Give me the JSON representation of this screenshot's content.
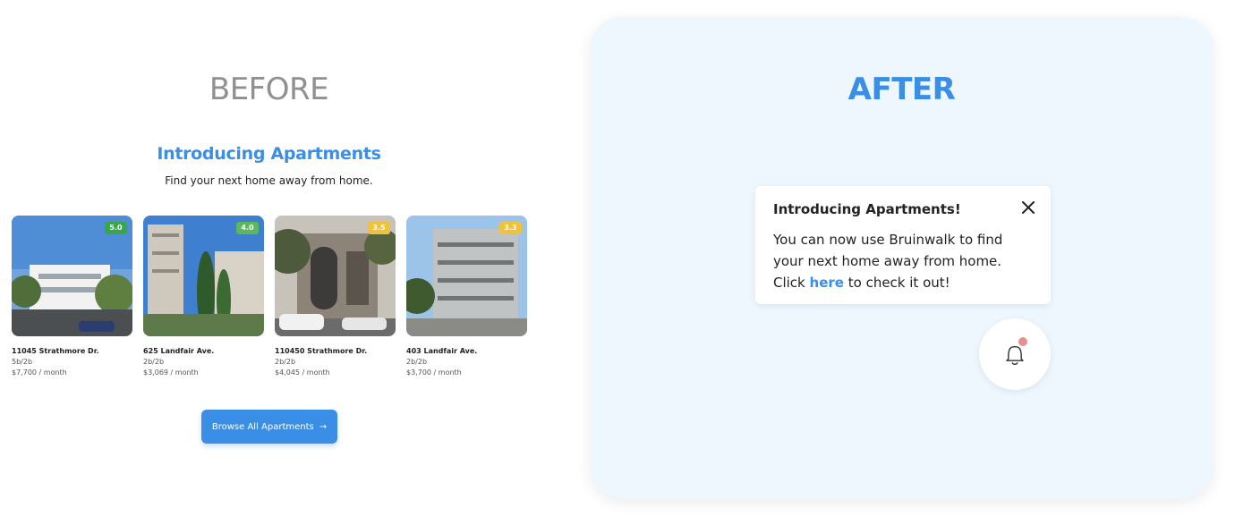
{
  "before": {
    "title": "BEFORE",
    "heading": "Introducing Apartments",
    "subheading": "Find your next home away from home.",
    "listings": [
      {
        "rating": "5.0",
        "rating_color": "#3aa64c",
        "address": "11045 Strathmore Dr.",
        "beds": "5b/2b",
        "price": "$7,700 / month"
      },
      {
        "rating": "4.0",
        "rating_color": "#5cb85c",
        "address": "625 Landfair Ave.",
        "beds": "2b/2b",
        "price": "$3,069 / month"
      },
      {
        "rating": "3.5",
        "rating_color": "#f0c23a",
        "address": "110450 Strathmore Dr.",
        "beds": "2b/2b",
        "price": "$4,045 / month"
      },
      {
        "rating": "3.3",
        "rating_color": "#f0c23a",
        "address": "403 Landfair Ave.",
        "beds": "2b/2b",
        "price": "$3,700 / month"
      }
    ],
    "browse_label": "Browse All Apartments",
    "browse_arrow": "→"
  },
  "after": {
    "title": "AFTER",
    "notice_title": "Introducing Apartments!",
    "notice_line1": "You can now use Bruinwalk to find",
    "notice_line2": "your next home away from home.",
    "notice_click": "Click",
    "notice_link": "here",
    "notice_tail": "to check it out!",
    "close_icon": "close-icon",
    "bell_icon": "bell-icon"
  },
  "colors": {
    "accent": "#3a8ee6",
    "after_bg": "#eef6fe",
    "notification_dot": "#e88f8f"
  }
}
